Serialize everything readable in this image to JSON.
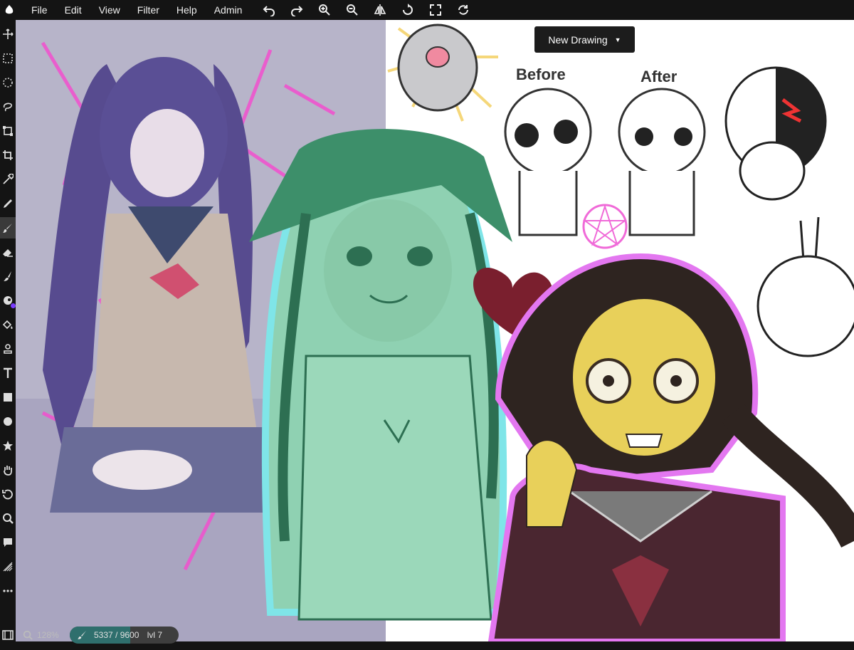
{
  "menu": {
    "items": [
      "File",
      "Edit",
      "View",
      "Filter",
      "Help",
      "Admin"
    ],
    "actions": [
      "undo-icon",
      "redo-icon",
      "zoom-in-icon",
      "zoom-out-icon",
      "flip-icon",
      "rotate-icon",
      "fullscreen-icon",
      "sync-icon"
    ]
  },
  "toolbar": {
    "tools": [
      "move-icon",
      "rect-select-icon",
      "ellipse-select-icon",
      "lasso-icon",
      "transform-icon",
      "crop-icon",
      "eyedropper-icon",
      "pencil-icon",
      "brush-icon",
      "eraser-icon",
      "smudge-icon",
      "color-icon",
      "fill-icon",
      "stamp-icon",
      "text-icon",
      "rectangle-icon",
      "circle-icon",
      "star-icon",
      "hand-icon",
      "rotate-view-icon",
      "zoom-tool-icon",
      "comment-icon",
      "gradient-icon",
      "more-icon"
    ],
    "active_tool": "brush-icon",
    "current_color": "#7b3cff"
  },
  "canvas": {
    "new_drawing_label": "New Drawing",
    "doodle_labels": {
      "before": "Before",
      "after": "After"
    }
  },
  "status": {
    "zoom": "128%",
    "xp": "5337 / 9600",
    "xp_progress": 0.556,
    "level": "lvl 7"
  }
}
